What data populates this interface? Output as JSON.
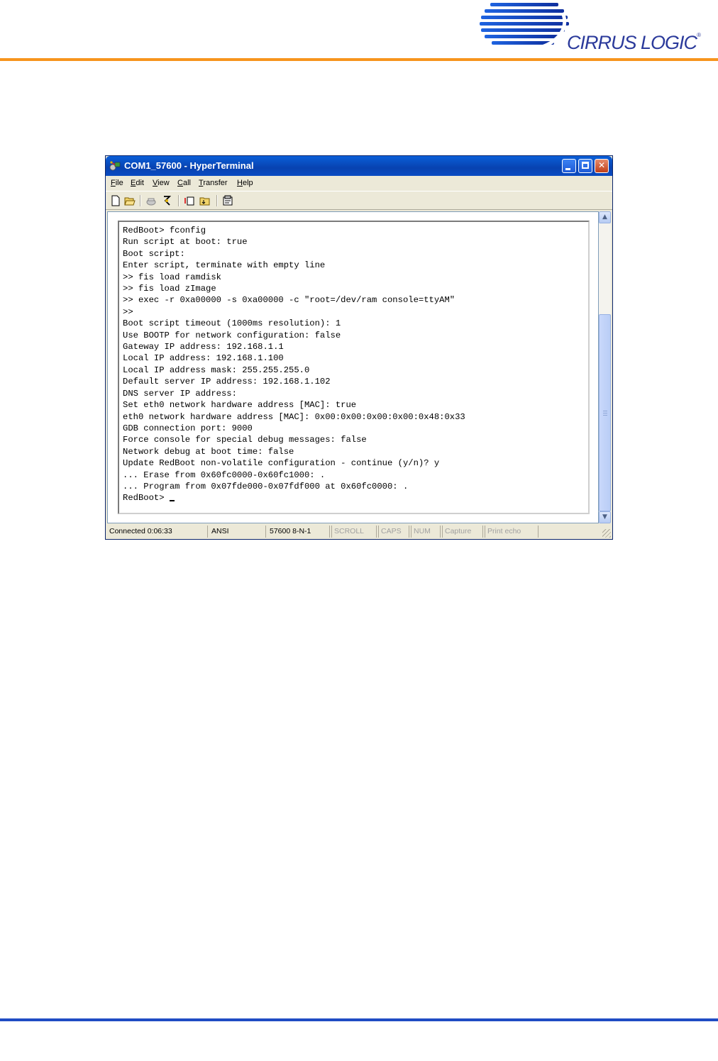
{
  "page": {
    "brand": "CIRRUS LOGIC",
    "brand_mark": "®",
    "header_rule_color": "#f7941d",
    "footer_rule_color": "#1f4cc4"
  },
  "window": {
    "title": "COM1_57600 - HyperTerminal",
    "app_icon": "hyperterminal-icon",
    "controls": [
      "minimize",
      "maximize",
      "close"
    ]
  },
  "menu": [
    "File",
    "Edit",
    "View",
    "Call",
    "Transfer",
    "Help"
  ],
  "toolbar_icons": [
    "new-icon",
    "open-icon",
    "phone-icon",
    "disconnect-icon",
    "send-icon",
    "receive-icon",
    "properties-icon"
  ],
  "terminal": {
    "lines": [
      "RedBoot> fconfig",
      "Run script at boot: true",
      "Boot script:",
      "Enter script, terminate with empty line",
      ">> fis load ramdisk",
      ">> fis load zImage",
      ">> exec -r 0xa00000 -s 0xa00000 -c \"root=/dev/ram console=ttyAM\"",
      ">>",
      "Boot script timeout (1000ms resolution): 1",
      "Use BOOTP for network configuration: false",
      "Gateway IP address: 192.168.1.1",
      "Local IP address: 192.168.1.100",
      "Local IP address mask: 255.255.255.0",
      "Default server IP address: 192.168.1.102",
      "DNS server IP address:",
      "Set eth0 network hardware address [MAC]: true",
      "eth0 network hardware address [MAC]: 0x00:0x00:0x00:0x00:0x48:0x33",
      "GDB connection port: 9000",
      "Force console for special debug messages: false",
      "Network debug at boot time: false",
      "Update RedBoot non-volatile configuration - continue (y/n)? y",
      "... Erase from 0x60fc0000-0x60fc1000: .",
      "... Program from 0x07fde000-0x07fdf000 at 0x60fc0000: .",
      "RedBoot> "
    ]
  },
  "status": {
    "connected": "Connected 0:06:33",
    "emulation": "ANSI",
    "port_settings": "57600 8-N-1",
    "scroll": "SCROLL",
    "caps": "CAPS",
    "num": "NUM",
    "capture": "Capture",
    "print_echo": "Print echo"
  }
}
